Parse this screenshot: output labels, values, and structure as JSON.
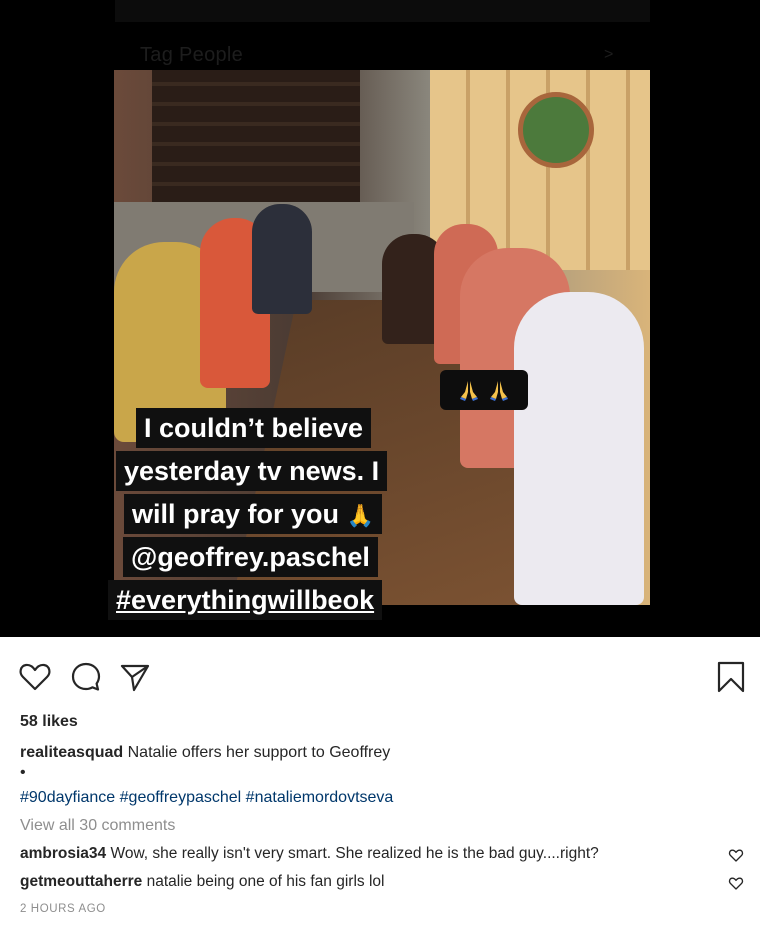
{
  "media": {
    "tag_hint": "Tag People",
    "tag_arrow": ">",
    "caption_lines": [
      "I couldn’t believe",
      "yesterday tv news. I",
      "will pray for you",
      "@geoffrey.paschel",
      "#everythingwillbeok"
    ],
    "emoji_sticker": "🙏🙏",
    "inline_emoji": "🙏"
  },
  "actions": {
    "like_icon": "heart-icon",
    "comment_icon": "comment-icon",
    "share_icon": "share-icon",
    "save_icon": "bookmark-icon"
  },
  "post": {
    "likes": "58 likes",
    "author": "realiteasquad",
    "caption": "Natalie offers her support to Geoffrey",
    "bullet": "•",
    "hashtags": [
      "#90dayfiance",
      "#geoffreypaschel",
      "#nataliemordovtseva"
    ],
    "view_all": "View all 30 comments",
    "comments": [
      {
        "user": "ambrosia34",
        "text": "Wow, she really isn't very smart. She realized he is the bad guy....right?"
      },
      {
        "user": "getmeouttaherre",
        "text": "natalie being one of his fan girls lol"
      }
    ],
    "timestamp": "2 HOURS AGO"
  },
  "colors": {
    "background": "#ffffff",
    "text": "#262626",
    "link": "#00376b",
    "muted": "#8e8e8e"
  }
}
